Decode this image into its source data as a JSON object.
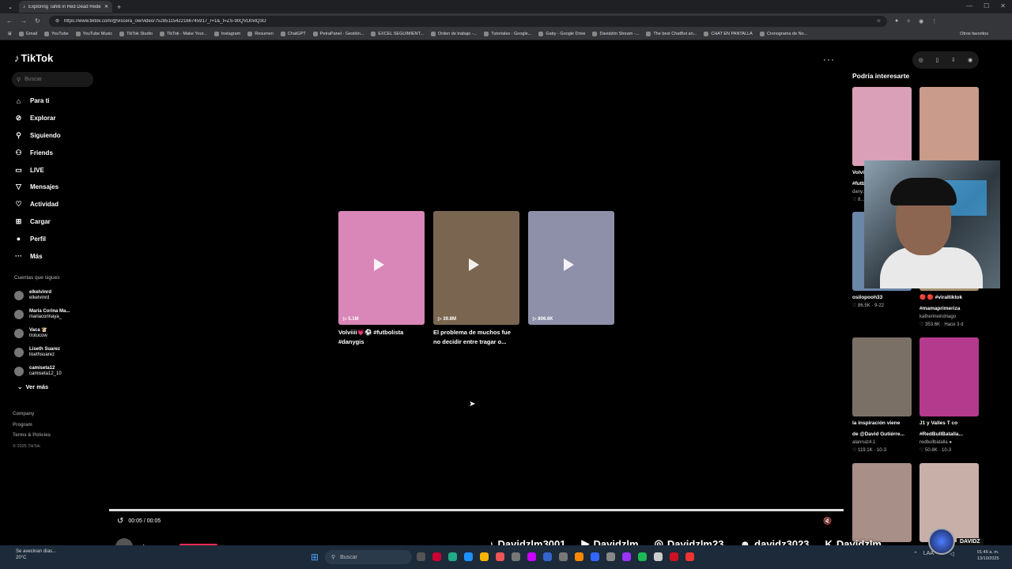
{
  "browser": {
    "tab_title": "Exploring Tahiti in Red Dead Rede...",
    "url": "https://www.tiktok.com/@viscera_ow/video/75285115422166745917_r=1&_t=ZS-90QVD0vlQ3O",
    "bookmarks": [
      "Gmail",
      "YouTube",
      "YouTube Music",
      "TikTok Studio",
      "TikTok - Make Your...",
      "Instagram",
      "Resumen",
      "ChatGPT",
      "PetraPanel - Gestión...",
      "EXCEL SEGUIMIENT...",
      "Orden de trabajo -...",
      "Tutoriales - Google...",
      "Gaby - Google Drive",
      "Davidzlm Stream -...",
      "The best ChatBot an...",
      "CHAT EN PANTALLA",
      "Cronograma de No..."
    ],
    "other_bookmarks": "Otros favoritos"
  },
  "sidebar": {
    "logo": "TikTok",
    "search_placeholder": "Buscar",
    "menu": [
      {
        "icon": "⌂",
        "label": "Para ti"
      },
      {
        "icon": "⊘",
        "label": "Explorar"
      },
      {
        "icon": "⚲",
        "label": "Siguiendo"
      },
      {
        "icon": "⚇",
        "label": "Friends"
      },
      {
        "icon": "▭",
        "label": "LIVE"
      },
      {
        "icon": "▽",
        "label": "Mensajes"
      },
      {
        "icon": "♡",
        "label": "Actividad"
      },
      {
        "icon": "⊞",
        "label": "Cargar"
      },
      {
        "icon": "●",
        "label": "Perfil"
      },
      {
        "icon": "···",
        "label": "Más"
      }
    ],
    "following_header": "Cuentas que sigues",
    "following": [
      {
        "name": "elkelvinrd",
        "handle": "elkelvinrd"
      },
      {
        "name": "Maria Corina Ma...",
        "handle": "mariacorinaya_"
      },
      {
        "name": "Vaca 🐮",
        "handle": "trotucow"
      },
      {
        "name": "Liseth Suarez",
        "handle": "lisethsuarez"
      },
      {
        "name": "camiseta12",
        "handle": "camiseta12_10"
      }
    ],
    "see_more": "Ver más",
    "footer": [
      "Company",
      "Program",
      "Terms & Policies"
    ],
    "copyright": "© 2025 TikTok"
  },
  "videos": [
    {
      "count": "5.1M",
      "caption": "Volviiii💗⚽ #futbolista #danygis",
      "color": "#d986b8"
    },
    {
      "count": "39.8M",
      "caption": "El problema de muchos fue no decidir entre tragar o...",
      "color": "#7a6650"
    },
    {
      "count": "806.6K",
      "caption": "",
      "color": "#8e8fa8"
    }
  ],
  "player": {
    "time": "00:05 / 00:05",
    "author": "viscera_ow"
  },
  "right_panel": {
    "header": "Podría interesarte",
    "items": [
      {
        "title": "Volvi...",
        "sub1": "#futb...",
        "sub2": "dany...",
        "stats": "♡ 8...",
        "color": "#d9a0b8"
      },
      {
        "title": "",
        "sub1": "",
        "sub2": "",
        "stats": "",
        "color": "#c99b8a"
      },
      {
        "title": "",
        "sub1": "osilopooh33",
        "sub2": "♡ 86.5K · 9-22",
        "stats": "",
        "color": "#6a86a8"
      },
      {
        "title": "🔴 🔴 #viraltiktok",
        "sub1": "#mamaprimeriza",
        "sub2": "katherineindriago",
        "stats": "♡ 353.6K · Hace 3 d",
        "color": "#a69272"
      },
      {
        "title": "la inspiración viene",
        "sub1": "de @David Gutiérre...",
        "sub2": "alanruiz4.1",
        "stats": "♡ 119.1K · 10-3",
        "color": "#7b7065"
      },
      {
        "title": "J1 y Valles T co",
        "sub1": "#RedBullBatalla...",
        "sub2": "redbullbatalla ●",
        "stats": "♡ 50.8K · 10-3",
        "color": "#b43a8e"
      },
      {
        "title": "",
        "sub1": "",
        "sub2": "",
        "stats": "",
        "color": "#a88f88"
      },
      {
        "title": "",
        "sub1": "",
        "sub2": "",
        "stats": "",
        "color": "#c8b0a8"
      }
    ]
  },
  "taskbar": {
    "weather_line1": "Se avecinan días...",
    "weather_line2": "20°C",
    "search": "Buscar",
    "time": "01:46 a. m.",
    "date": "13/10/2025",
    "lang": "LAA"
  },
  "overlay": {
    "tiktok": "Davidzlm3001",
    "youtube": "Davidzlm",
    "instagram": "Davidzlm23",
    "discord": "davidz3023",
    "kick": "Davidzlm",
    "brand": "DAVIDZ"
  }
}
